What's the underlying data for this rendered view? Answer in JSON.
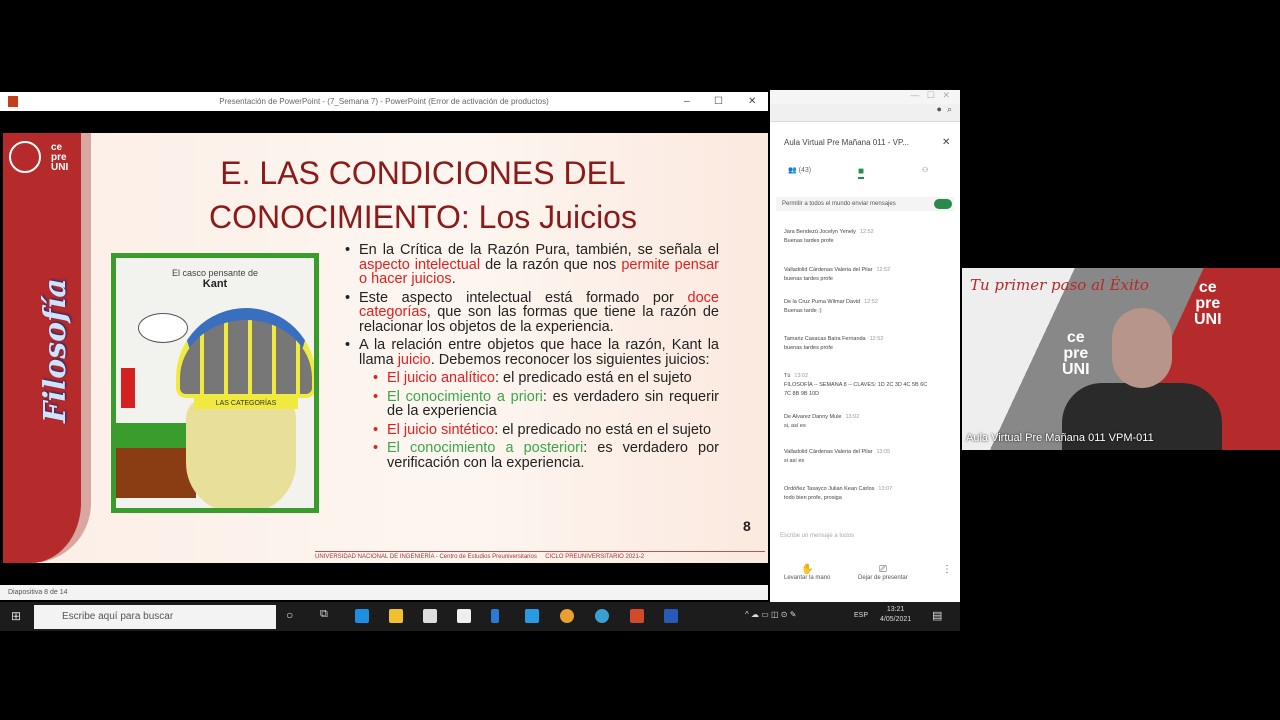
{
  "ppt": {
    "window_title": "Presentación de PowerPoint - (7_Semana 7) - PowerPoint (Error de activación de productos)",
    "status": "Diapositiva 8 de 14"
  },
  "slide": {
    "logo": "ce pre UNI",
    "side_label": "Filosofía",
    "title_line1": "E. LAS CONDICIONES DEL",
    "title_line2": "CONOCIMIENTO: Los Juicios",
    "image_caption": "El casco pensante de",
    "image_caption_name": "Kant",
    "image_label": "LAS CATEGORÍAS",
    "b1a": "En la Crítica de la Razón Pura, también, se señala el ",
    "b1r": "aspecto intelectual",
    "b1b": " de la razón que nos ",
    "b1r2": "permite pensar o hacer juicios",
    "b2a": "Este aspecto intelectual está formado por ",
    "b2r": "doce categorías",
    "b2b": ", que son las formas que tiene la razón de relacionar los objetos de la experiencia.",
    "b3a": "A la relación entre objetos que hace la razón, Kant la llama ",
    "b3r": "juicio",
    "b3b": ". Debemos reconocer los siguientes juicios:",
    "s1k": "El juicio analítico",
    "s1v": ": el predicado está en el sujeto",
    "s2k": "El conocimiento  a priori",
    "s2v": ": es verdadero sin requerir de la experiencia",
    "s3k": "El juicio sintético",
    "s3v": ": el predicado no está en el sujeto",
    "s4k": "El conocimiento a posteriori",
    "s4v": ": es verdadero por verificación con la experiencia.",
    "page": "8",
    "footer_left": "UNIVERSIDAD NACIONAL DE INGENIERÍA - Centro de Estudios Preuniversitarios",
    "footer_right": "CICLO PREUNIVERSITARIO 2021-2"
  },
  "teams": {
    "title": "Aula Virtual Pre Mañana 011 - VP...",
    "participants": "(43)",
    "toggle_label": "Permitir a todos el mundo enviar mensajes",
    "messages": [
      {
        "name": "Jara Bendezú Jocelyn Yenely",
        "time": "12:52",
        "text": "Buenas tardes profe"
      },
      {
        "name": "Valladolid Cárdenas Valeria del Pilar",
        "time": "12:52",
        "text": "buenas tardes profe"
      },
      {
        "name": "De la Cruz Puma Wilmar David",
        "time": "12:52",
        "text": "Buenas tarde :)"
      },
      {
        "name": "Tamariz Casacas Baira Fernanda",
        "time": "12:52",
        "text": "buenas tardes profe"
      },
      {
        "name": "Tú",
        "time": "13:02",
        "text": "FILOSOFÍA -- SEMANA 8 -- CLAVES: 1D 2C 3D 4C 5B 6C 7C 8B 9B 10D"
      },
      {
        "name": "De Alvarez Danny Mule",
        "time": "13:02",
        "text": "si, así es"
      },
      {
        "name": "Valladolid Cárdenas Valeria del Pilar",
        "time": "13:05",
        "text": "si así es"
      },
      {
        "name": "Ordóñez Tasayco Julian Kean Carlos",
        "time": "13:07",
        "text": "todo bien profe, prosiga"
      }
    ],
    "input_placeholder": "Escribe un mensaje a todos",
    "raise_hand": "Levantar la mano",
    "stop_presenting": "Dejar de presentar"
  },
  "camera": {
    "slogan": "Tu primer paso al Éxito",
    "logo": "ce pre UNI",
    "label": "Aula Virtual Pre Mañana 011 VPM-011"
  },
  "taskbar": {
    "search_placeholder": "Escribe aquí para buscar",
    "lang": "ESP",
    "time": "13:21",
    "date": "4/05/2021"
  }
}
